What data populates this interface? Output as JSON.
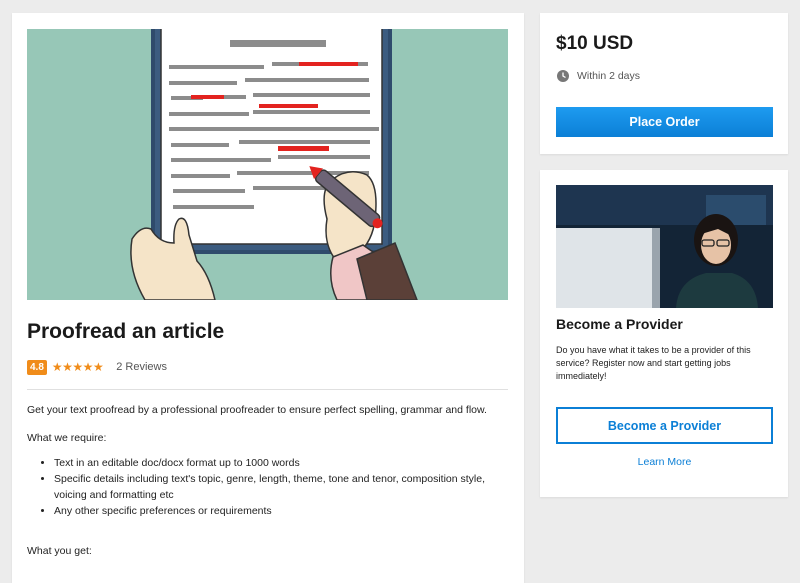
{
  "listing": {
    "title": "Proofread an article",
    "rating": "4.8",
    "stars": "★★★★★",
    "reviews_text": "2 Reviews",
    "description": "Get your text proofread by a professional proofreader to ensure perfect spelling, grammar and flow.",
    "requirements_label": "What  we require:",
    "requirements": [
      "Text in an editable doc/docx format up to 1000 words",
      "Specific details including text's topic, genre, length, theme, tone and tenor, composition style, voicing and formatting etc",
      "Any other specific preferences or requirements"
    ],
    "deliverables_label": "What you get:"
  },
  "order": {
    "price": "$10 USD",
    "delivery_time": "Within 2 days",
    "button_label": "Place Order"
  },
  "provider": {
    "title": "Become a Provider",
    "text": "Do you have what it takes to be a provider of this service? Register now and start getting jobs immediately!",
    "button_label": "Become a Provider",
    "learn_more": "Learn More"
  },
  "colors": {
    "accent": "#0b7fd6",
    "rating": "#f08c1a",
    "hero_bg": "#97c7b7",
    "clipboard": "#2f4b6c"
  },
  "icons": {
    "delivery": "clock-icon",
    "rating": "star-icon"
  }
}
